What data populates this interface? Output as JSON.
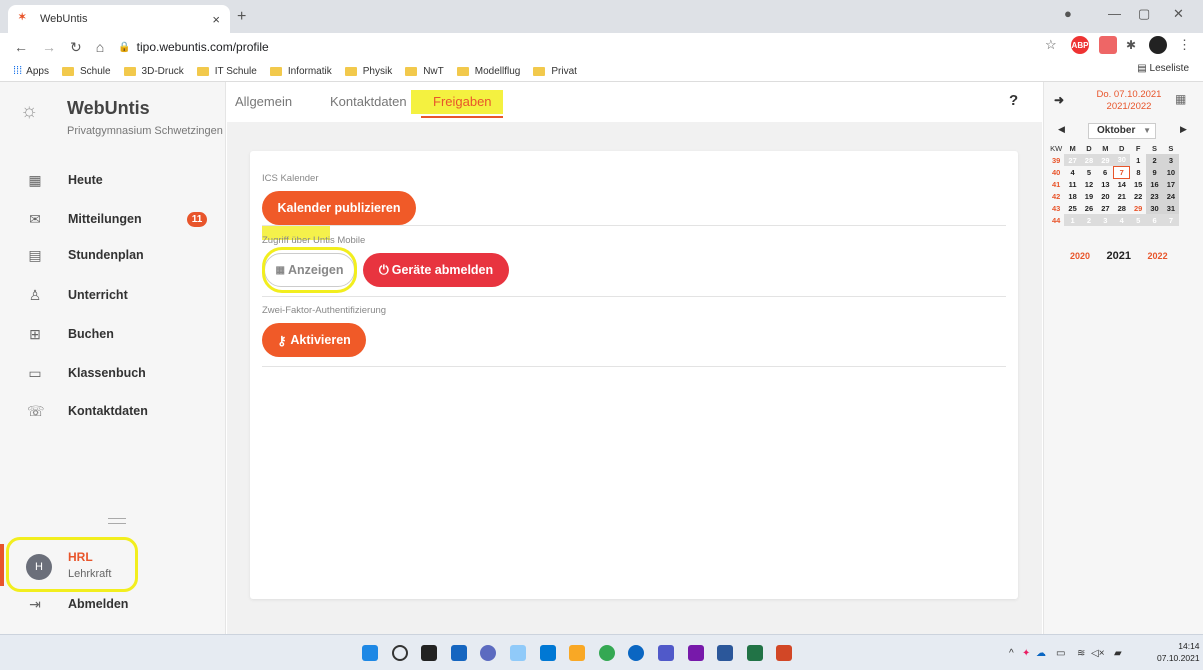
{
  "browser": {
    "tab_title": "WebUntis",
    "tab_close": "×",
    "new_tab": "+",
    "url": "tipo.webuntis.com/profile",
    "bookmarks": [
      "Schule",
      "3D-Druck",
      "IT Schule",
      "Informatik",
      "Physik",
      "NwT",
      "Modellflug",
      "Privat"
    ],
    "apps_label": "Apps",
    "reading_list": "Leseliste",
    "ext_abp": "ABP"
  },
  "sidebar": {
    "app_name": "WebUntis",
    "school": "Privatgymnasium Schwetzingen",
    "items": [
      {
        "label": "Heute",
        "icon": "dashboard-icon"
      },
      {
        "label": "Mitteilungen",
        "icon": "mail-icon",
        "badge": "11"
      },
      {
        "label": "Stundenplan",
        "icon": "calendar-icon"
      },
      {
        "label": "Unterricht",
        "icon": "teacher-icon"
      },
      {
        "label": "Buchen",
        "icon": "calendar-plus-icon"
      },
      {
        "label": "Klassenbuch",
        "icon": "book-icon"
      },
      {
        "label": "Kontaktdaten",
        "icon": "contact-icon"
      }
    ],
    "user": {
      "initial": "H",
      "name": "HRL",
      "role": "Lehrkraft"
    },
    "logout": "Abmelden"
  },
  "profile_tabs": [
    {
      "label": "Allgemein",
      "active": false
    },
    {
      "label": "Kontaktdaten",
      "active": false
    },
    {
      "label": "Freigaben",
      "active": true
    }
  ],
  "help_label": "?",
  "sections": {
    "ics": {
      "title": "ICS Kalender",
      "button": "Kalender publizieren"
    },
    "mobile": {
      "title": "Zugriff über Untis Mobile",
      "show_button": "Anzeigen",
      "logout_devices_button": "Geräte abmelden"
    },
    "twofa": {
      "title": "Zwei-Faktor-Authentifizierung",
      "button": "Aktivieren"
    }
  },
  "calendar": {
    "date": "Do. 07.10.2021",
    "school_year": "2021/2022",
    "month": "Oktober",
    "headers": [
      "KW",
      "M",
      "D",
      "M",
      "D",
      "F",
      "S",
      "S"
    ],
    "weeks": [
      {
        "kw": "39",
        "days": [
          "27",
          "28",
          "29",
          "30",
          "1",
          "2",
          "3"
        ]
      },
      {
        "kw": "40",
        "days": [
          "4",
          "5",
          "6",
          "7",
          "8",
          "9",
          "10"
        ]
      },
      {
        "kw": "41",
        "days": [
          "11",
          "12",
          "13",
          "14",
          "15",
          "16",
          "17"
        ]
      },
      {
        "kw": "42",
        "days": [
          "18",
          "19",
          "20",
          "21",
          "22",
          "23",
          "24"
        ]
      },
      {
        "kw": "43",
        "days": [
          "25",
          "26",
          "27",
          "28",
          "29",
          "30",
          "31"
        ]
      },
      {
        "kw": "44",
        "days": [
          "1",
          "2",
          "3",
          "4",
          "5",
          "6",
          "7"
        ]
      }
    ],
    "years": [
      "2020",
      "2021",
      "2022"
    ]
  },
  "taskbar": {
    "time": "14:14",
    "date": "07.10.2021"
  },
  "colors": {
    "accent": "#e8552b",
    "button_orange": "#f05a28",
    "button_red": "#e8343f",
    "highlight": "#f2ee1e"
  }
}
